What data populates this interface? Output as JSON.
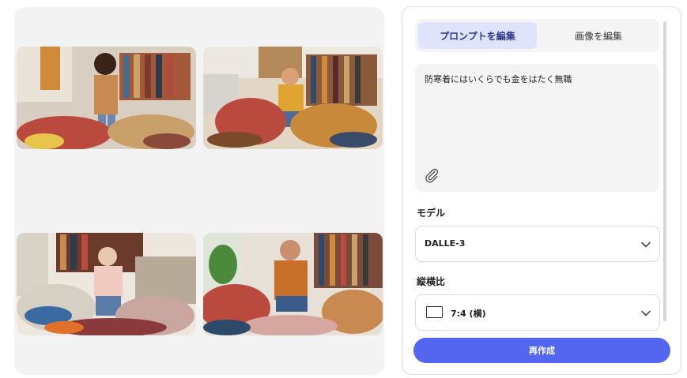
{
  "gallery": {
    "images": [
      {
        "alt": "image-1"
      },
      {
        "alt": "image-2"
      },
      {
        "alt": "image-3"
      },
      {
        "alt": "image-4"
      }
    ]
  },
  "tabs": {
    "edit_prompt": "プロンプトを編集",
    "edit_image": "画像を編集"
  },
  "prompt": {
    "text": "防寒着にはいくらでも金をはたく無職"
  },
  "model": {
    "label": "モデル",
    "value": "DALLE-3"
  },
  "aspect_ratio": {
    "label": "縦横比",
    "value": "7:4 (横)"
  },
  "regenerate_button": "再作成",
  "colors": {
    "accent": "#5465f0",
    "active_tab_bg": "#dfe3fb",
    "panel_bg": "#f3f3f3"
  },
  "icons": {
    "attach": "paperclip-icon",
    "dropdown": "chevron-down-icon",
    "ratio": "landscape-rect-icon"
  }
}
